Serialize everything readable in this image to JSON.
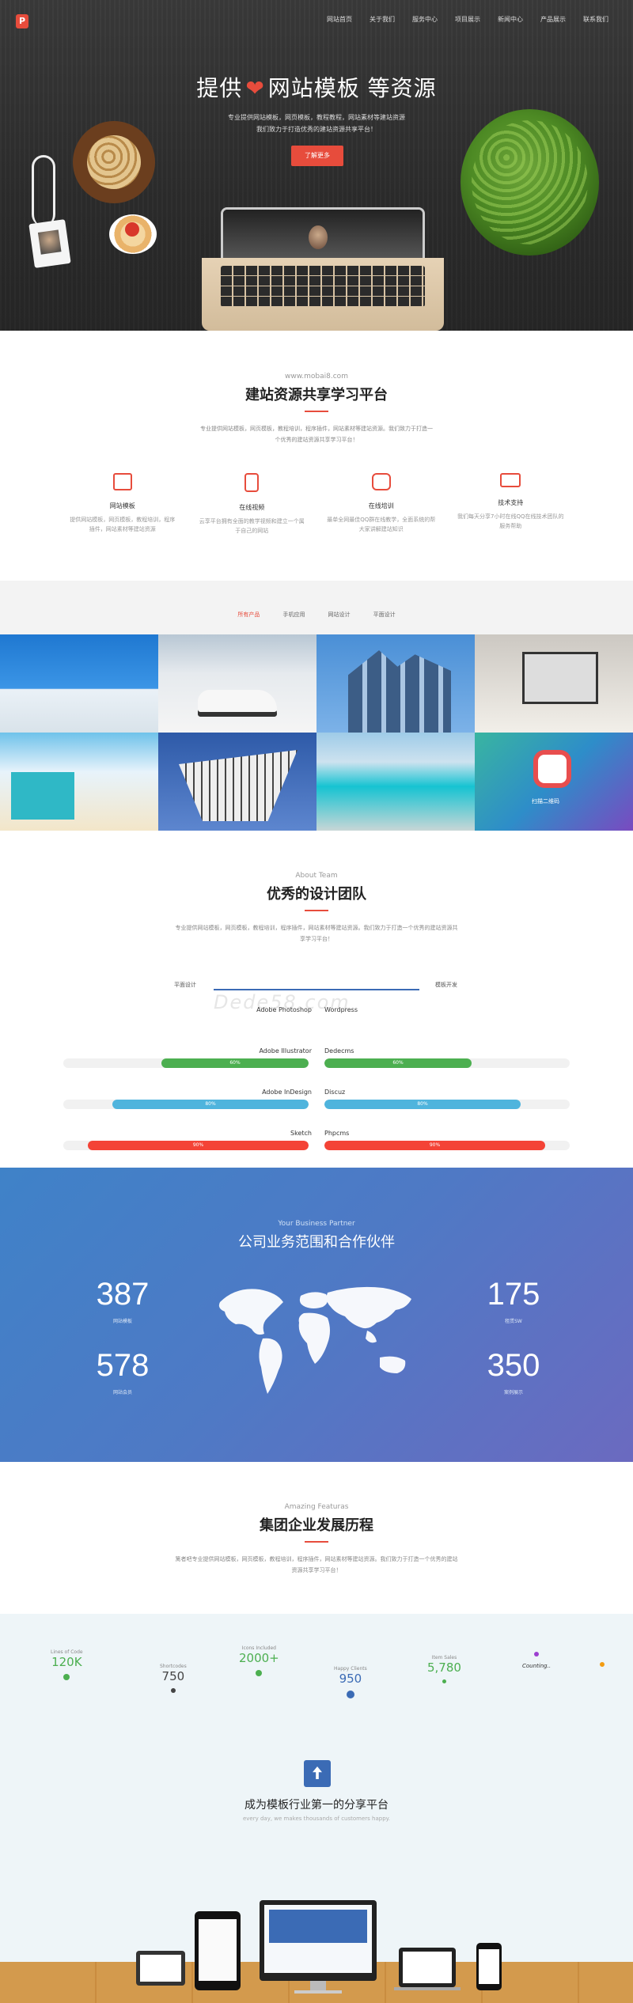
{
  "header": {
    "logo_text": "P",
    "nav": [
      "网站首页",
      "关于我们",
      "服务中心",
      "项目展示",
      "新闻中心",
      "产品展示",
      "联系我们"
    ]
  },
  "hero": {
    "title_left": "提供",
    "title_right": "网站模板  等资源",
    "sub_line1": "专业提供网站模板，网页模板，教程教程，网站素材等建站资源",
    "sub_line2": "我们致力于打造优秀的建站资源共享平台！",
    "button": "了解更多"
  },
  "platform": {
    "en": "www.mobai8.com",
    "cn": "建站资源共享学习平台",
    "desc": "专业提供网站模板，网页模板，教程培训，程序插件，网站素材等建站资源。我们致力于打造一个优秀的建站资源共享学习平台！",
    "features": [
      {
        "icon": "layers-icon",
        "title": "网站模板",
        "desc": "提供网站模板，网页模板，教程培训，程序插件，网站素材等建站资源"
      },
      {
        "icon": "mobile-icon",
        "title": "在线视频",
        "desc": "云享平台拥有全面的教学视频和建立一个属于自己的网站"
      },
      {
        "icon": "camera-icon",
        "title": "在线培训",
        "desc": "最单全网最佳QQ群在线教学，全面系统的帮大家讲解建站知识"
      },
      {
        "icon": "briefcase-icon",
        "title": "技术支持",
        "desc": "我们每天分享7小时在线QQ在线技术团队的服务帮助"
      }
    ]
  },
  "tabs": {
    "items": [
      "所有产品",
      "手机应用",
      "网站设计",
      "平面设计"
    ],
    "active": 0
  },
  "gallery": {
    "overlay_text": "扫描二维码"
  },
  "team": {
    "en": "About Team",
    "cn": "优秀的设计团队",
    "desc": "专业提供网站模板，网页模板，教程培训，程序插件，网站素材等建站资源。我们致力于打造一个优秀的建站资源共享学习平台！",
    "col_left": "平面设计",
    "col_right": "模板开发",
    "watermark": "Dede58.com",
    "skills": [
      {
        "left": {
          "name": "Adobe Photoshop",
          "pct": "",
          "percent": 0,
          "color": "#3b6bb5"
        },
        "right": {
          "name": "Wordpress",
          "pct": "",
          "percent": 0,
          "color": "#3b6bb5"
        }
      },
      {
        "left": {
          "name": "Adobe Illustrator",
          "pct": "60%",
          "percent": 60,
          "color": "#4caf50"
        },
        "right": {
          "name": "Dedecms",
          "pct": "60%",
          "percent": 60,
          "color": "#4caf50"
        }
      },
      {
        "left": {
          "name": "Adobe InDesign",
          "pct": "80%",
          "percent": 80,
          "color": "#4fb4dd"
        },
        "right": {
          "name": "Discuz",
          "pct": "80%",
          "percent": 80,
          "color": "#4fb4dd"
        }
      },
      {
        "left": {
          "name": "Sketch",
          "pct": "90%",
          "percent": 90,
          "color": "#f44336"
        },
        "right": {
          "name": "Phpcms",
          "pct": "90%",
          "percent": 90,
          "color": "#f44336"
        }
      }
    ]
  },
  "partners": {
    "en": "Your Business Partner",
    "cn": "公司业务范围和合作伙伴",
    "stats": [
      {
        "num": "387",
        "label": "网站模板"
      },
      {
        "num": "175",
        "label": "租赁SW"
      },
      {
        "num": "578",
        "label": "网站会员"
      },
      {
        "num": "350",
        "label": "案例展示"
      }
    ]
  },
  "history": {
    "en": "Amazing Featuras",
    "cn": "集团企业发展历程",
    "desc": "篱者吧专业提供网站模板，网页模板，教程培训，程序插件，网站素材等建站资源。我们致力于打造一个优秀的建站资源共享学习平台！",
    "milestones": [
      {
        "label": "Lines of Code",
        "value": "120K",
        "color": "#4caf50"
      },
      {
        "label": "Shortcodes",
        "value": "750",
        "color": "#444444"
      },
      {
        "label": "Icons Included",
        "value": "2000+",
        "color": "#4caf50"
      },
      {
        "label": "Happy Clients",
        "value": "950",
        "color": "#3b6bb5"
      },
      {
        "label": "Item Sales",
        "value": "5,780",
        "color": "#4caf50"
      },
      {
        "label": "",
        "value": "Counting..",
        "color": "#9c3fd0"
      }
    ]
  },
  "share": {
    "title": "成为模板行业第一的分享平台",
    "sub": "every day, we makes thousands of customers happy.",
    "platforms": [
      "android-icon",
      "apple-icon",
      "amazon-icon",
      "windows-icon"
    ]
  }
}
